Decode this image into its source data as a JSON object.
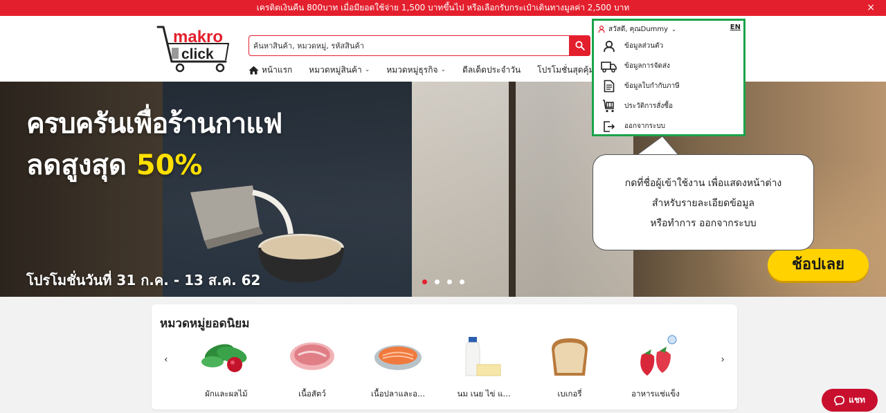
{
  "promo": {
    "text": "เครดิตเงินคืน 800บาท เมื่อมียอดใช้จ่าย 1,500 บาทขึ้นไป หรือเลือกรับกระเป๋าเดินทางมูลค่า 2,500 บาท",
    "close": "×"
  },
  "logo": {
    "word1": "makro",
    "word2": "click"
  },
  "search": {
    "placeholder": "ค้นหาสินค้า, หมวดหมู่, รหัสสินค้า"
  },
  "nav": {
    "home": "หน้าแรก",
    "categories": "หมวดหมู่สินค้า",
    "business": "หมวดหมู่ธุรกิจ",
    "daily_deals": "ดีลเด็ดประจำวัน",
    "promotions": "โปรโมชั่นสุดคุ้ม"
  },
  "user_menu": {
    "greeting": "สวัสดี, คุณDummy",
    "lang": "EN",
    "items": [
      {
        "label": "ข้อมูลส่วนตัว",
        "icon": "person-icon"
      },
      {
        "label": "ข้อมูลการจัดส่ง",
        "icon": "truck-icon"
      },
      {
        "label": "ข้อมูลใบกำกับภาษี",
        "icon": "document-icon"
      },
      {
        "label": "ประวัติการสั่งซื้อ",
        "icon": "cart-icon"
      },
      {
        "label": "ออกจากระบบ",
        "icon": "logout-icon"
      }
    ]
  },
  "tooltip": {
    "line1": "กดที่ชื่อผู้เข้าใช้งาน เพื่อแสดงหน้าต่าง",
    "line2": "สำหรับรายละเอียดข้อมูล",
    "line3": "หรือทำการ ออกจากระบบ"
  },
  "hero": {
    "line1": "ครบครันเพื่อร้านกาแฟ",
    "line2_prefix": "ลดสูงสุด",
    "line2_highlight": "50%",
    "date": "โปรโมชั่นวันที่ 31 ก.ค. - 13 ส.ค. 62",
    "cta": "ช้อปเลย",
    "slides_total": 4,
    "active_slide": 1
  },
  "popular": {
    "title": "หมวดหมู่ยอดนิยม",
    "prev": "‹",
    "next": "›",
    "items": [
      {
        "label": "ผักและผลไม้"
      },
      {
        "label": "เนื้อสัตว์"
      },
      {
        "label": "เนื้อปลาและอ..."
      },
      {
        "label": "นม เนย ไข่ แ..."
      },
      {
        "label": "เบเกอรี่"
      },
      {
        "label": "อาหารแช่แข็ง"
      }
    ]
  },
  "chat": {
    "label": "แชท"
  },
  "colors": {
    "brand_red": "#e41f2d",
    "highlight_green": "#1aa34a",
    "cta_yellow": "#ffd200"
  }
}
